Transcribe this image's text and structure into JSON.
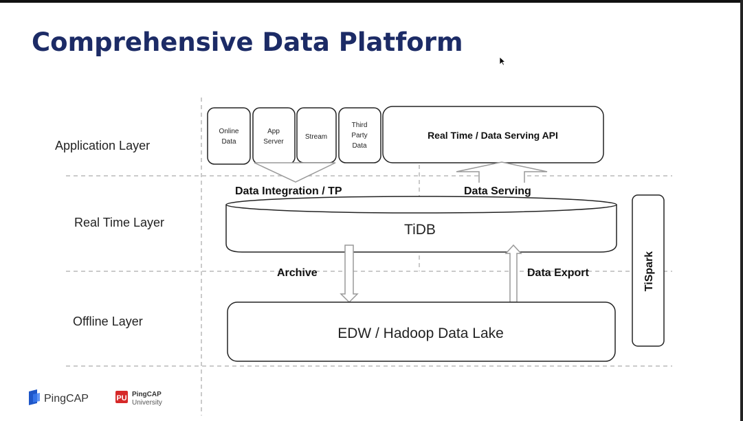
{
  "title": "Comprehensive Data Platform",
  "layers": {
    "application": "Application Layer",
    "realtime": "Real Time Layer",
    "offline": "Offline Layer"
  },
  "sources": {
    "online_data": [
      "Online",
      "Data"
    ],
    "app_server": [
      "App",
      "Server"
    ],
    "stream": [
      "Stream"
    ],
    "third_party": [
      "Third",
      "Party",
      "Data"
    ]
  },
  "api_box": "Real Time / Data Serving API",
  "flows": {
    "integration": "Data Integration / TP",
    "serving": "Data Serving",
    "archive": "Archive",
    "export": "Data Export"
  },
  "tidb": "TiDB",
  "edw": "EDW / Hadoop Data Lake",
  "tispark": "TiSpark",
  "logos": {
    "pingcap": "PingCAP",
    "univ_line1": "PingCAP",
    "univ_line2": "University"
  },
  "colors": {
    "title": "#1c2b66",
    "pingcap_blue": "#1e56c8",
    "university_red": "#d62828"
  }
}
